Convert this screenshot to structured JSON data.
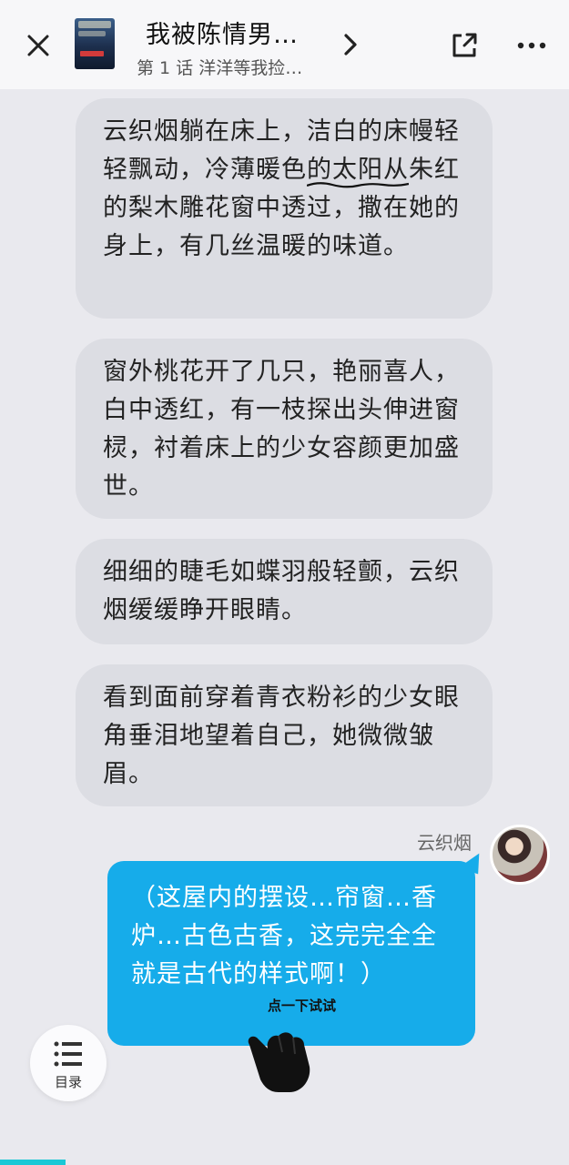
{
  "header": {
    "title": "我被陈情男…",
    "subtitle": "第 1 话 洋洋等我捡…",
    "cover_icon": "book-cover",
    "close_icon": "close-icon",
    "share_icon": "share-icon",
    "more_icon": "more-icon"
  },
  "messages": [
    {
      "text_a": "云织烟躺在床上，洁白的床幔轻轻飘动，冷薄暖色",
      "text_underlined": "的太阳从",
      "text_b": "朱红的梨木雕花窗中透过，撒在她的身上，有几丝温暖的味道。"
    },
    {
      "text": "窗外桃花开了几只，艳丽喜人，白中透红，有一枝探出头伸进窗棂，衬着床上的少女容颜更加盛世。"
    },
    {
      "text": "细细的睫毛如蝶羽般轻颤，云织烟缓缓睁开眼睛。"
    },
    {
      "text": "看到面前穿着青衣粉衫的少女眼角垂泪地望着自己，她微微皱眉。"
    }
  ],
  "character_reply": {
    "speaker": "云织烟",
    "text": "（这屋内的摆设…帘窗…香炉…古色古香，这完完全全就是古代的样式啊！）",
    "tap_hint": "点一下试试"
  },
  "toc": {
    "label": "目录",
    "icon": "list-icon"
  },
  "colors": {
    "background": "#e9e9ee",
    "narration_bubble": "#dcdde3",
    "reply_bubble": "#16acea",
    "accent": "#1bc8d6"
  }
}
